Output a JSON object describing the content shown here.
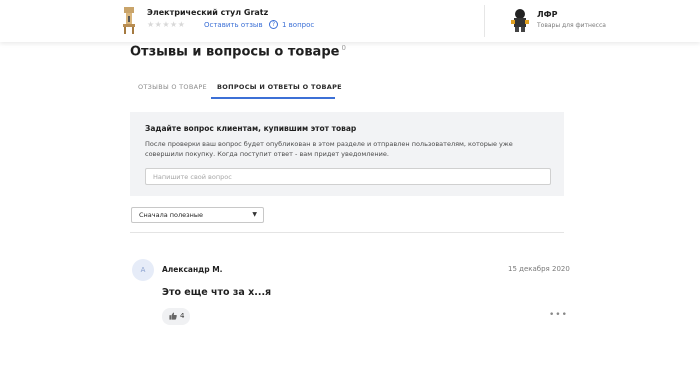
{
  "header": {
    "product_title": "Электрический стул Gratz",
    "stars": "★★★★★",
    "leave_review": "Оставить отзыв",
    "questions_icon": "question-bubble-icon",
    "questions_count": "1 вопрос",
    "seller_name": "ЛФР",
    "seller_subtitle": "Товары для фитнесса"
  },
  "page": {
    "title": "Отзывы и вопросы о товаре",
    "title_count": "0"
  },
  "tabs": [
    {
      "label": "ОТЗЫВЫ О ТОВАРЕ",
      "active": false
    },
    {
      "label": "ВОПРОСЫ И ОТВЕТЫ О ТОВАРЕ",
      "active": true
    }
  ],
  "ask": {
    "title": "Задайте вопрос клиентам, купившим этот товар",
    "description": "После проверки ваш вопрос будет опубликован в этом разделе и отправлен пользователям, которые уже совершили покупку. Когда поступит ответ - вам придет уведомление.",
    "placeholder": "Напишите свой вопрос"
  },
  "sort": {
    "selected": "Сначала полезные",
    "caret_icon": "caret-down-icon"
  },
  "reviews": [
    {
      "avatar_letter": "А",
      "author": "Александр М.",
      "date": "15 декабря 2020",
      "text": "Это еще что за х...я",
      "likes": "4",
      "more": "•••"
    }
  ],
  "colors": {
    "accent": "#3c70d6",
    "panel": "#f2f3f5",
    "avatar_bg": "#e6ecf8"
  }
}
